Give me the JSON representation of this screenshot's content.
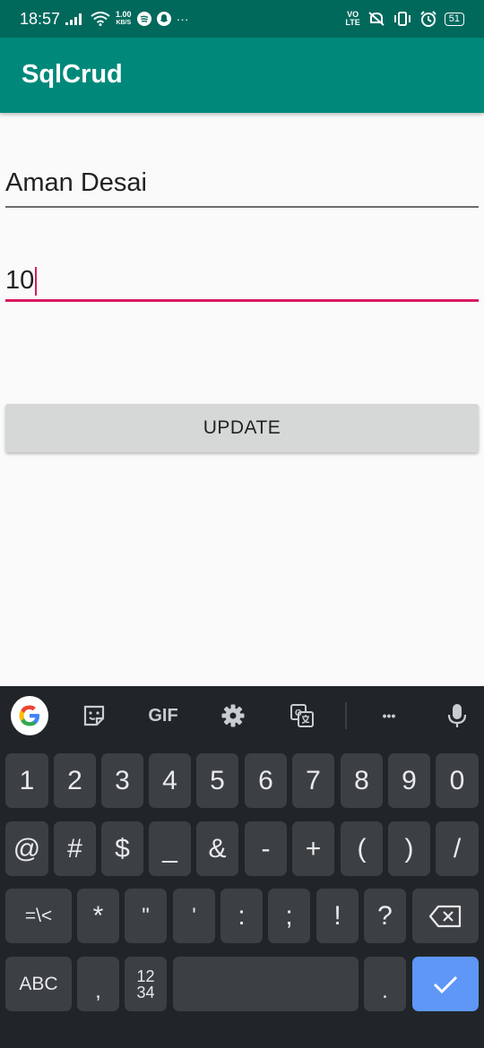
{
  "status_bar": {
    "time": "18:57",
    "net_speed_value": "1.00",
    "net_speed_unit": "KB/S",
    "volte_top": "VO",
    "volte_bottom": "LTE",
    "battery": "51",
    "overflow": "···"
  },
  "app_bar": {
    "title": "SqlCrud"
  },
  "form": {
    "name_value": "Aman Desai",
    "number_value": "10",
    "update_label": "UPDATE"
  },
  "keyboard": {
    "toolbar": {
      "gif_label": "GIF",
      "more_label": "•••"
    },
    "row1": [
      "1",
      "2",
      "3",
      "4",
      "5",
      "6",
      "7",
      "8",
      "9",
      "0"
    ],
    "row2": [
      "@",
      "#",
      "$",
      "_",
      "&",
      "-",
      "+",
      "(",
      ")",
      "/"
    ],
    "row3": [
      "=\\<",
      "*",
      "\"",
      "'",
      ":",
      ";",
      "!",
      "?"
    ],
    "row4": {
      "abc": "ABC",
      "comma": ",",
      "num_top": "12",
      "num_bottom": "34",
      "period": "."
    }
  },
  "colors": {
    "status_bar": "#00695c",
    "app_bar": "#00897b",
    "accent": "#d81b60",
    "keyboard_bg": "#212529",
    "key_bg": "#3c4043",
    "enter_key": "#5e97f6"
  }
}
